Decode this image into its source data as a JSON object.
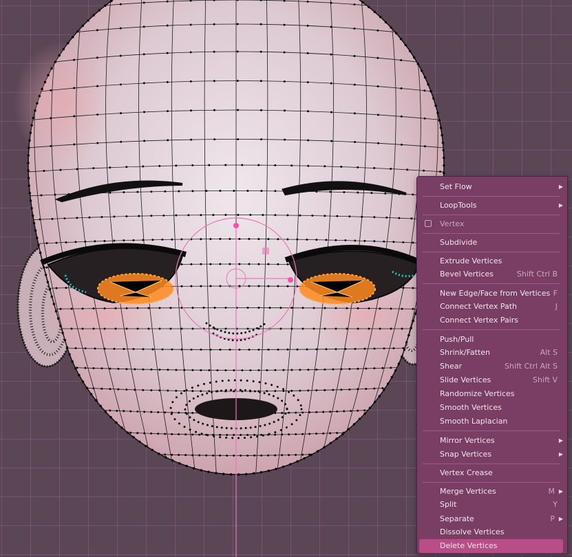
{
  "context_menu": {
    "header": "Vertex",
    "items": [
      {
        "label": "Set Flow",
        "shortcut": "",
        "submenu": true
      },
      {
        "label": "LoopTools",
        "shortcut": "",
        "submenu": true
      },
      {
        "label": "Subdivide",
        "shortcut": "",
        "submenu": false
      },
      {
        "label": "Extrude Vertices",
        "shortcut": "",
        "submenu": false
      },
      {
        "label": "Bevel Vertices",
        "shortcut": "Shift Ctrl B",
        "submenu": false
      },
      {
        "label": "New Edge/Face from Vertices",
        "shortcut": "F",
        "submenu": false
      },
      {
        "label": "Connect Vertex Path",
        "shortcut": "J",
        "submenu": false
      },
      {
        "label": "Connect Vertex Pairs",
        "shortcut": "",
        "submenu": false
      },
      {
        "label": "Push/Pull",
        "shortcut": "",
        "submenu": false
      },
      {
        "label": "Shrink/Fatten",
        "shortcut": "Alt S",
        "submenu": false
      },
      {
        "label": "Shear",
        "shortcut": "Shift Ctrl Alt S",
        "submenu": false
      },
      {
        "label": "Slide Vertices",
        "shortcut": "Shift V",
        "submenu": false
      },
      {
        "label": "Randomize Vertices",
        "shortcut": "",
        "submenu": false
      },
      {
        "label": "Smooth Vertices",
        "shortcut": "",
        "submenu": false
      },
      {
        "label": "Smooth Laplacian",
        "shortcut": "",
        "submenu": false
      },
      {
        "label": "Mirror Vertices",
        "shortcut": "",
        "submenu": true
      },
      {
        "label": "Snap Vertices",
        "shortcut": "",
        "submenu": true
      },
      {
        "label": "Vertex Crease",
        "shortcut": "",
        "submenu": false
      },
      {
        "label": "Merge Vertices",
        "shortcut": "M",
        "submenu": true
      },
      {
        "label": "Split",
        "shortcut": "Y",
        "submenu": false
      },
      {
        "label": "Separate",
        "shortcut": "P",
        "submenu": true
      },
      {
        "label": "Dissolve Vertices",
        "shortcut": "",
        "submenu": false
      },
      {
        "label": "Delete Vertices",
        "shortcut": "",
        "submenu": false,
        "highlighted": true
      }
    ]
  },
  "colors": {
    "viewport_bg": "#5b4656",
    "menu_bg": "#7a3d64",
    "menu_highlight": "#b84d87",
    "selection_orange": "#ff8a1e",
    "gizmo_pink": "#e67ab8"
  }
}
